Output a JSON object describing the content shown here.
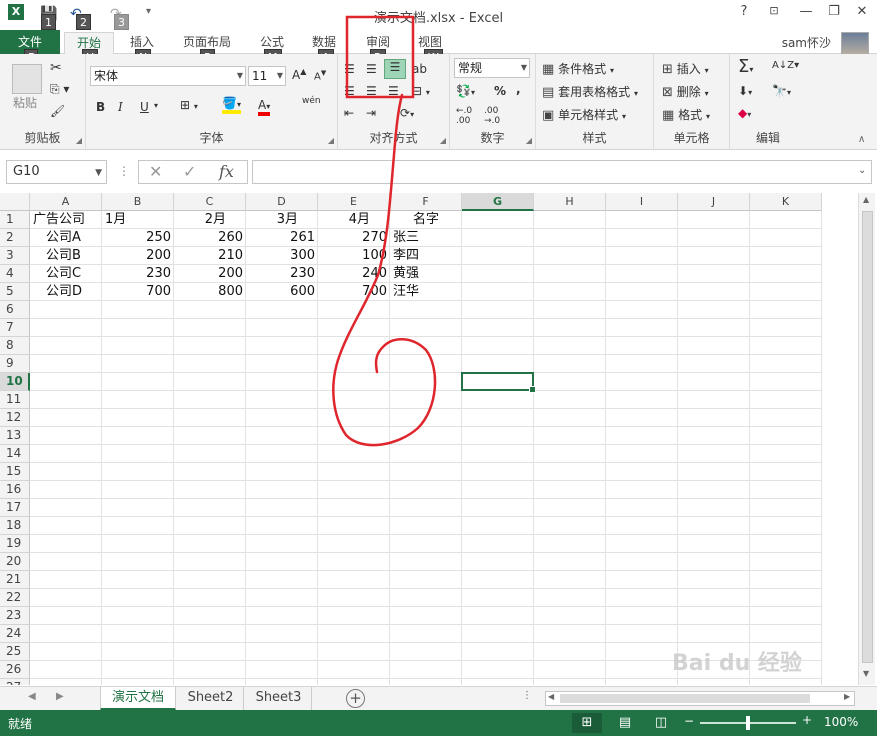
{
  "window": {
    "title": "演示文档.xlsx - Excel",
    "help": "?",
    "minimize": "—",
    "restore": "❐",
    "close": "✕"
  },
  "keytips": {
    "save": "1",
    "undo": "2",
    "redo": "3",
    "file": "F",
    "home": "H",
    "insert": "N",
    "layout": "P",
    "formula": "M",
    "data": "A",
    "review": "R",
    "view": "W"
  },
  "tabs": {
    "file": "文件",
    "home": "开始",
    "insert": "插入",
    "layout": "页面布局",
    "formula": "公式",
    "data": "数据",
    "review": "审阅",
    "view": "视图"
  },
  "user": "sam怀沙",
  "ribbon": {
    "clipboard": {
      "label": "剪贴板",
      "paste": "粘贴"
    },
    "font": {
      "label": "字体",
      "name": "宋体",
      "size": "11",
      "bold": "B",
      "italic": "I",
      "underline": "U",
      "phonetic": "wén"
    },
    "alignment": {
      "label": "对齐方式"
    },
    "number": {
      "label": "数字",
      "format": "常规"
    },
    "styles": {
      "label": "样式",
      "conditional": "条件格式",
      "table": "套用表格格式",
      "cell": "单元格样式"
    },
    "cells": {
      "label": "单元格",
      "insert": "插入",
      "delete": "删除",
      "format": "格式"
    },
    "editing": {
      "label": "编辑"
    }
  },
  "formula_bar": {
    "name_box": "G10",
    "fx": "fx",
    "content": ""
  },
  "columns": [
    "A",
    "B",
    "C",
    "D",
    "E",
    "F",
    "G",
    "H",
    "I",
    "J",
    "K"
  ],
  "rows": [
    "1",
    "2",
    "3",
    "4",
    "5",
    "6",
    "7",
    "8",
    "9",
    "10",
    "11",
    "12",
    "13",
    "14",
    "15",
    "16",
    "17",
    "18",
    "19",
    "20",
    "21",
    "22",
    "23",
    "24",
    "25",
    "26",
    "27"
  ],
  "selected": {
    "column": "G",
    "row": "10"
  },
  "cells": {
    "header": [
      "广告公司",
      "1月",
      "2月",
      "3月",
      "4月",
      "名字"
    ],
    "data": [
      [
        "公司A",
        "250",
        "260",
        "261",
        "270",
        "张三"
      ],
      [
        "公司B",
        "200",
        "210",
        "300",
        "100",
        "李四"
      ],
      [
        "公司C",
        "230",
        "200",
        "230",
        "240",
        "黄强"
      ],
      [
        "公司D",
        "700",
        "800",
        "600",
        "700",
        "汪华"
      ]
    ]
  },
  "sheets": [
    "演示文档",
    "Sheet2",
    "Sheet3"
  ],
  "active_sheet": 0,
  "status": {
    "ready": "就绪",
    "zoom": "100%",
    "zoom_level": 1.0
  },
  "watermark": "Bai du 经验",
  "colors": {
    "accent": "#217346",
    "annotation": "#e0262d"
  }
}
